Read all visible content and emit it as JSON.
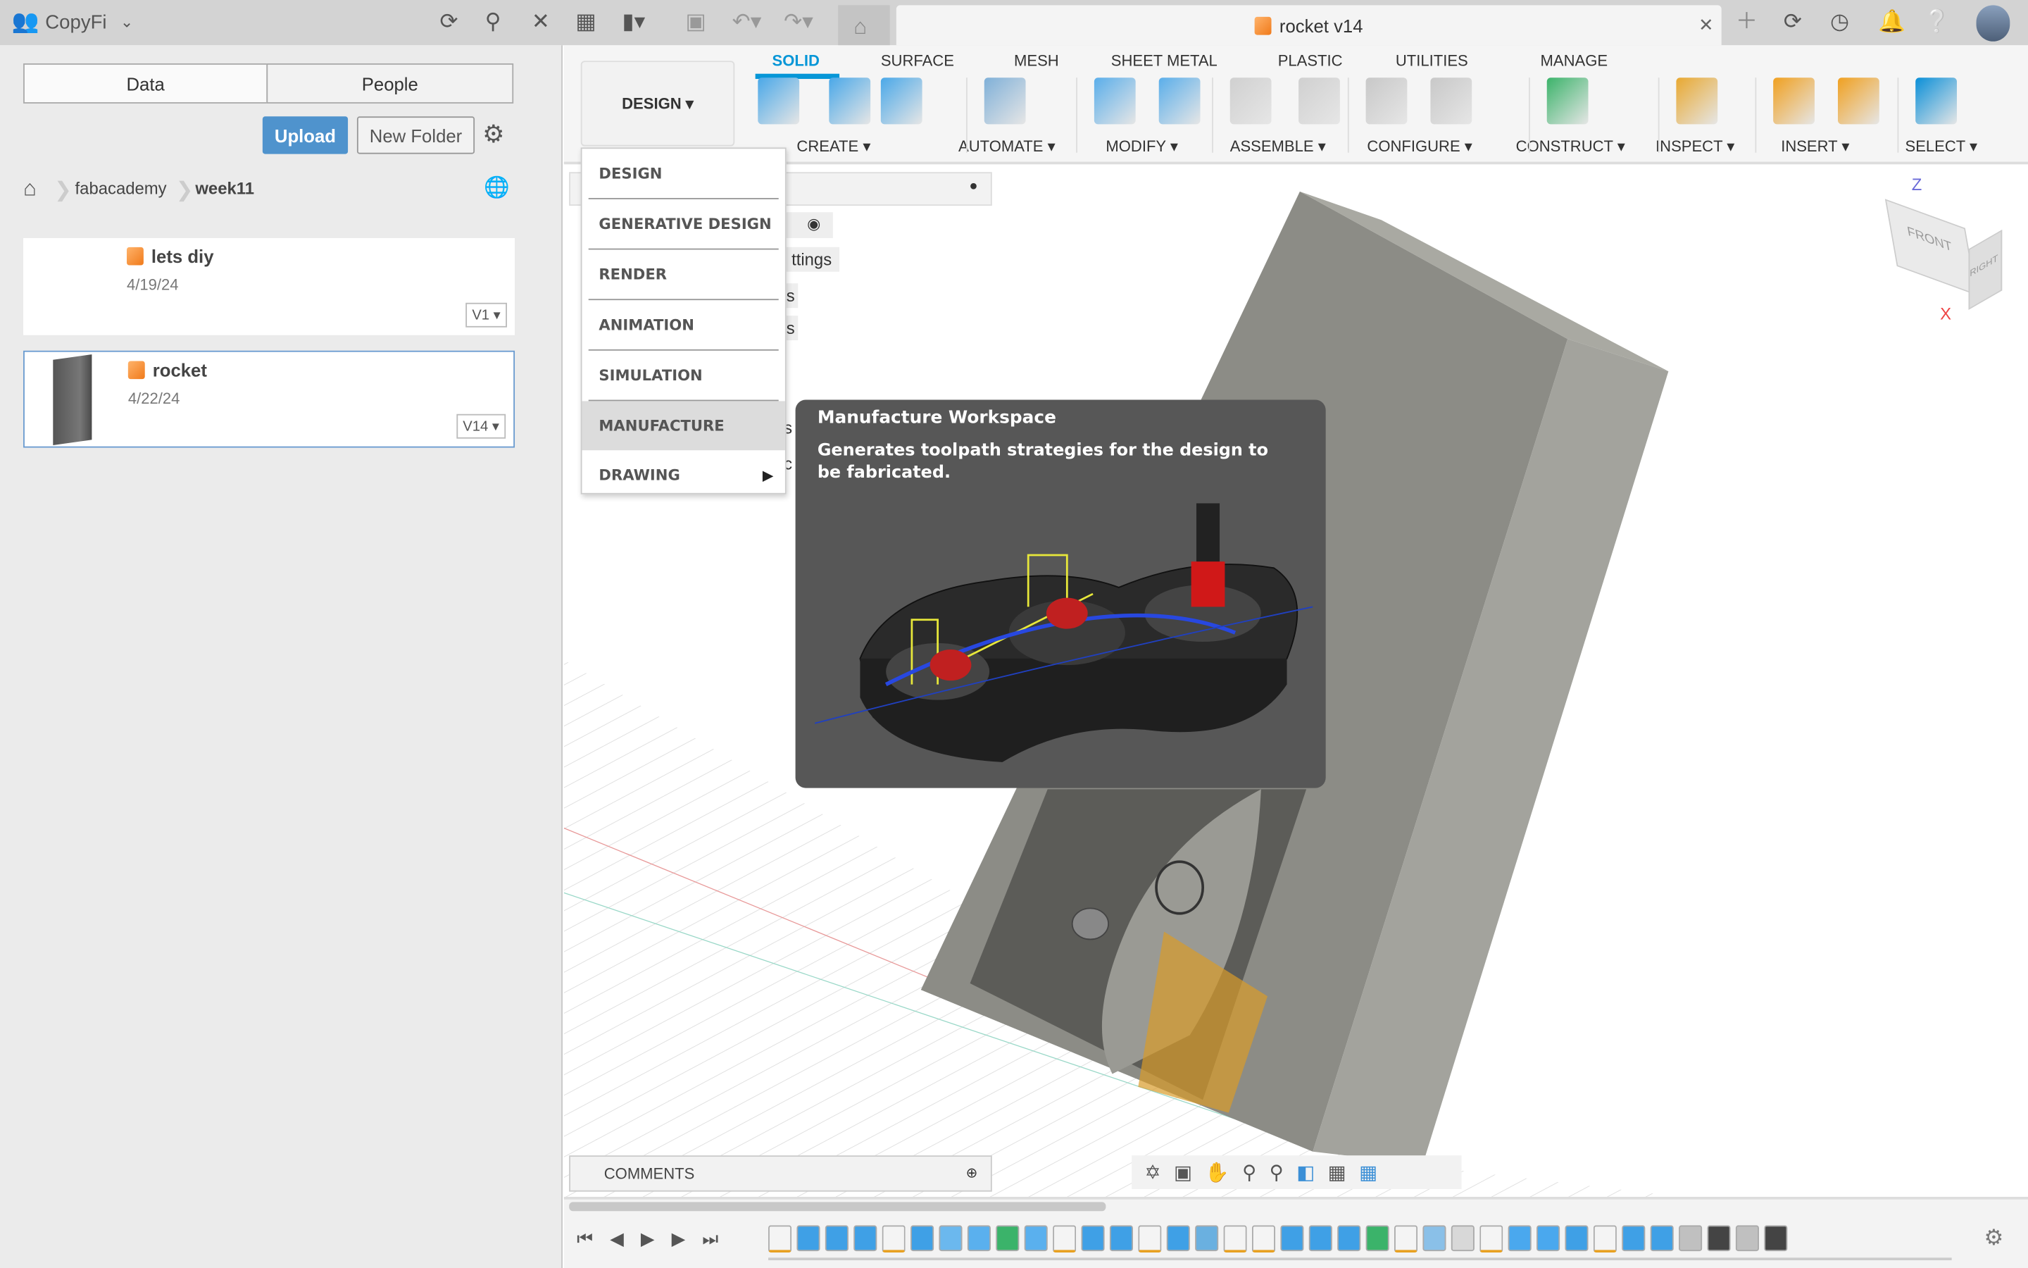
{
  "topbar": {
    "team": "CopyFi",
    "icons": [
      "refresh-icon",
      "search-icon",
      "close-icon",
      "grid-icon",
      "file-icon",
      "save-icon",
      "undo-icon",
      "redo-icon",
      "home-icon"
    ],
    "doc_title": "rocket v14",
    "right_icons": [
      "plus-icon",
      "extensions-icon",
      "clock-icon",
      "bell-icon",
      "help-icon",
      "avatar"
    ]
  },
  "data_panel": {
    "tabs": [
      "Data",
      "People"
    ],
    "upload": "Upload",
    "new_folder": "New Folder",
    "breadcrumb": [
      "fabacademy",
      "week11"
    ],
    "files": [
      {
        "name": "lets diy",
        "date": "4/19/24",
        "version": "V1"
      },
      {
        "name": "rocket",
        "date": "4/22/24",
        "version": "V14"
      }
    ]
  },
  "toolbar": {
    "workspace": "DESIGN",
    "tabs": [
      "SOLID",
      "SURFACE",
      "MESH",
      "SHEET METAL",
      "PLASTIC",
      "UTILITIES",
      "MANAGE"
    ],
    "active_tab": "SOLID",
    "groups": [
      "CREATE",
      "AUTOMATE",
      "MODIFY",
      "ASSEMBLE",
      "CONFIGURE",
      "CONSTRUCT",
      "INSPECT",
      "INSERT",
      "SELECT"
    ],
    "accent": "#0696d7"
  },
  "workspace_menu": {
    "items": [
      "DESIGN",
      "GENERATIVE DESIGN",
      "RENDER",
      "ANIMATION",
      "SIMULATION",
      "MANUFACTURE",
      "DRAWING"
    ],
    "highlighted": "MANUFACTURE"
  },
  "tooltip": {
    "title": "Manufacture Workspace",
    "body": "Generates toolpath strategies for the design to be fabricated."
  },
  "browser_fragments": [
    "ttings",
    "s",
    "s",
    "s",
    "c"
  ],
  "viewcube": {
    "front": "FRONT",
    "right": "RIGHT",
    "z": "Z",
    "x": "X"
  },
  "comments": {
    "label": "COMMENTS"
  },
  "timeline": {
    "features": [
      "sketch",
      "extrude",
      "revolve",
      "revolve",
      "sketch",
      "extrude",
      "pattern",
      "body",
      "plane",
      "body",
      "sketch",
      "extrude",
      "extrude",
      "sketch",
      "extrude",
      "shell",
      "sketch",
      "sketch",
      "extrude",
      "extrude",
      "extrude",
      "plane",
      "sketch",
      "sweep",
      "loft",
      "sketch",
      "sphere",
      "cone",
      "combine",
      "sketch",
      "extrude",
      "extrude",
      "joint",
      "move",
      "joint",
      "move"
    ]
  }
}
